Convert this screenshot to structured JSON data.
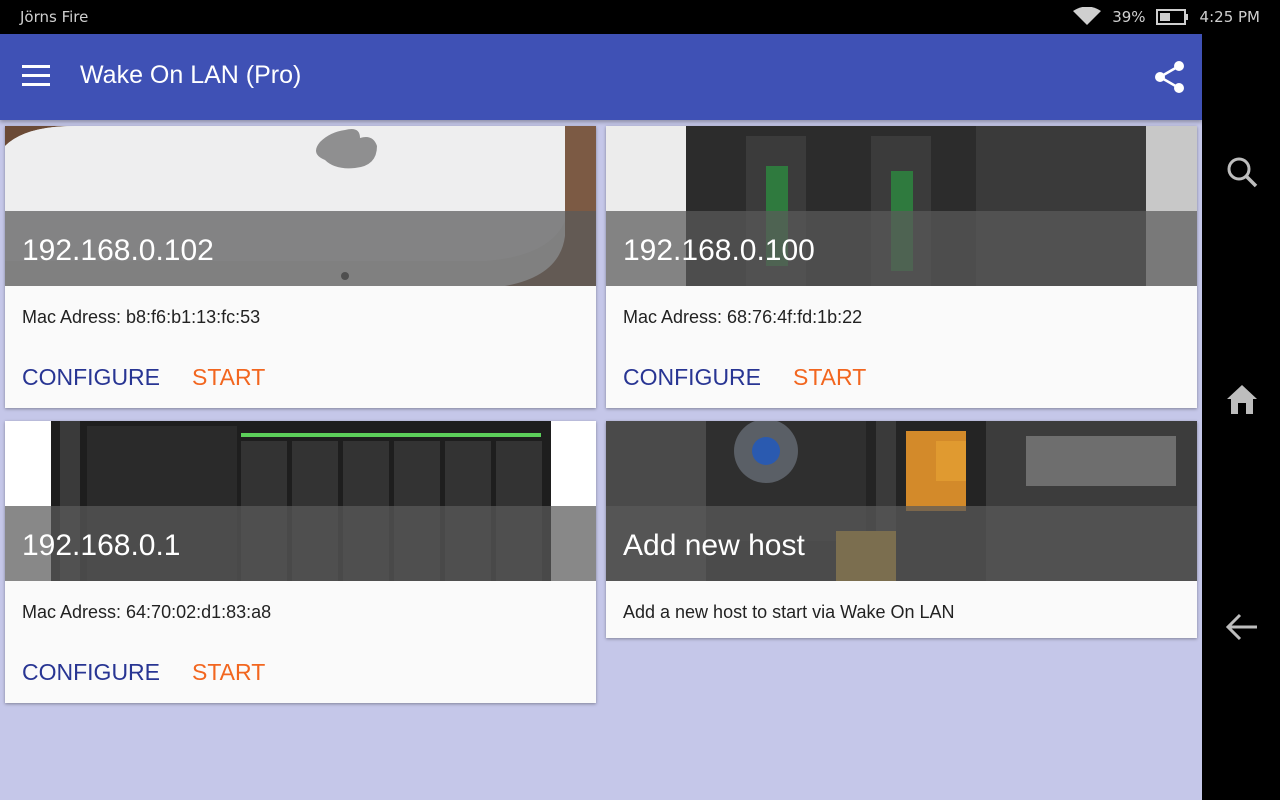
{
  "status_bar": {
    "device_name": "Jörns Fire",
    "battery": "39%",
    "time": "4:25 PM",
    "icons": [
      "wifi-icon",
      "battery-icon"
    ]
  },
  "app_bar": {
    "title": "Wake On LAN (Pro)",
    "icons": [
      "menu-icon",
      "share-icon"
    ]
  },
  "hosts": [
    {
      "ip": "192.168.0.102",
      "mac": "Mac Adress: b8:f6:b1:13:fc:53",
      "configure_label": "CONFIGURE",
      "start_label": "START",
      "image": "mac-mini-image"
    },
    {
      "ip": "192.168.0.100",
      "mac": "Mac Adress: 68:76:4f:fd:1b:22",
      "configure_label": "CONFIGURE",
      "start_label": "START",
      "image": "synology-nas-image"
    },
    {
      "ip": "192.168.0.1",
      "mac": "Mac Adress: 64:70:02:d1:83:a8",
      "configure_label": "CONFIGURE",
      "start_label": "START",
      "image": "nas-bays-image"
    }
  ],
  "add_host": {
    "title": "Add new host",
    "description": "Add a new host to start via Wake On LAN",
    "image": "motherboard-image"
  },
  "nav_bar": {
    "icons": [
      "search-icon",
      "home-icon",
      "back-icon"
    ]
  },
  "colors": {
    "app_bar": "#3f51b5",
    "background": "#c5c7e9",
    "configure": "#283593",
    "start": "#f2661f"
  }
}
